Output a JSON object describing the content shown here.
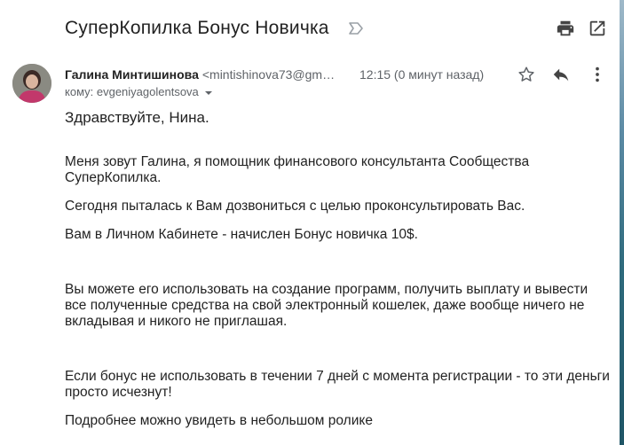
{
  "email": {
    "subject": "СуперКопилка Бонус Новичка",
    "sender_name": "Галина Минтишинова",
    "sender_email": "<mintishinova73@gm…",
    "time": "12:15 (0 минут назад)",
    "to_label": "кому: evgeniyagolentsova",
    "body": {
      "greeting": "Здравствуйте, Нина.",
      "p1": "Меня зовут Галина, я помощник финансового консультанта  Сообщества СуперКопилка.",
      "p2": "Сегодня пыталась к Вам дозвониться с целью проконсультировать Вас.",
      "p3": "Вам в Личном Кабинете - начислен Бонус новичка 10$.",
      "p4": "Вы можете его использовать на создание программ, получить выплату и вывести все полученные средства на свой электронный кошелек, даже вообще ничего не вкладывая и никого не приглашая.",
      "p5": "Если бонус не использовать в течении 7 дней с момента регистрации - то эти деньги просто исчезнут!",
      "p6": "Подробнее можно увидеть в небольшом ролике"
    }
  },
  "icons": {
    "label": "label-outline-icon",
    "print": "print-icon",
    "popout": "open-in-new-window-icon",
    "star": "star-icon",
    "reply": "reply-icon",
    "more": "more-vert-icon",
    "dropdown": "dropdown-arrow-icon"
  },
  "colors": {
    "text": "#222222",
    "secondary": "#5f6368",
    "icon": "#444444"
  }
}
